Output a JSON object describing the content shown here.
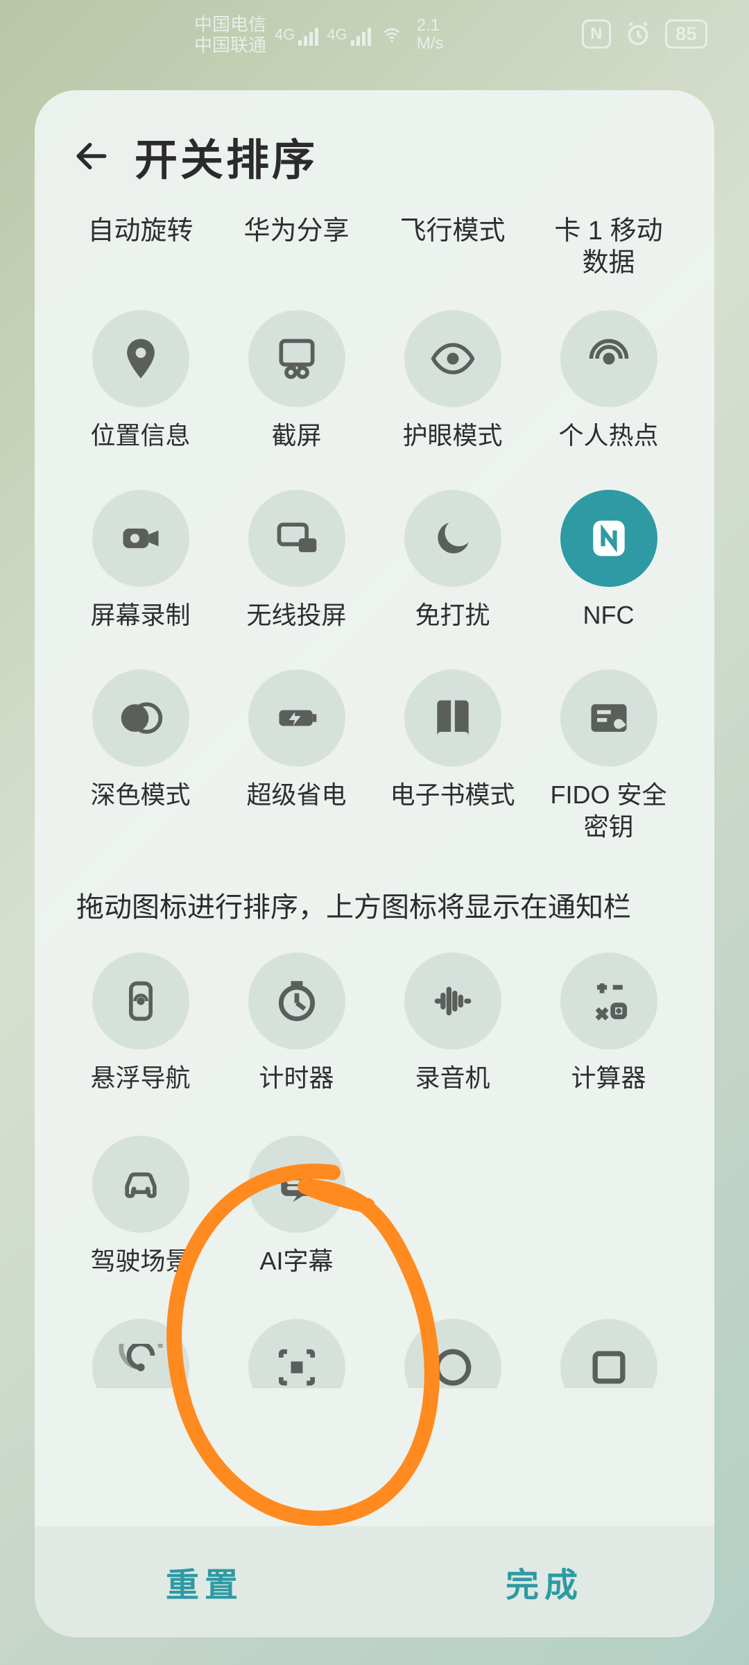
{
  "status": {
    "carrier1": "中国电信",
    "carrier2": "中国联通",
    "net_tag": "4G",
    "speed_value": "2.1",
    "speed_unit": "M/s",
    "nfc": "N",
    "battery": "85"
  },
  "header": {
    "title": "开关排序"
  },
  "top_labels": [
    "自动旋转",
    "华为分享",
    "飞行模式",
    "卡 1 移动数据"
  ],
  "toggles_row1": [
    {
      "label": "位置信息",
      "icon": "location-pin",
      "active": false
    },
    {
      "label": "截屏",
      "icon": "scissors",
      "active": false
    },
    {
      "label": "护眼模式",
      "icon": "eye",
      "active": false
    },
    {
      "label": "个人热点",
      "icon": "hotspot",
      "active": false
    }
  ],
  "toggles_row2": [
    {
      "label": "屏幕录制",
      "icon": "video-camera",
      "active": false
    },
    {
      "label": "无线投屏",
      "icon": "cast",
      "active": false
    },
    {
      "label": "免打扰",
      "icon": "moon",
      "active": false
    },
    {
      "label": "NFC",
      "icon": "nfc",
      "active": true
    }
  ],
  "toggles_row3": [
    {
      "label": "深色模式",
      "icon": "contrast",
      "active": false
    },
    {
      "label": "超级省电",
      "icon": "battery-bolt",
      "active": false
    },
    {
      "label": "电子书模式",
      "icon": "book",
      "active": false
    },
    {
      "label": "FIDO 安全密钥",
      "icon": "key-badge",
      "active": false
    }
  ],
  "hint": "拖动图标进行排序，上方图标将显示在通知栏",
  "bottom_row1": [
    {
      "label": "悬浮导航",
      "icon": "float-nav",
      "active": false
    },
    {
      "label": "计时器",
      "icon": "timer",
      "active": false
    },
    {
      "label": "录音机",
      "icon": "sound-wave",
      "active": false
    },
    {
      "label": "计算器",
      "icon": "calculator",
      "active": false
    }
  ],
  "bottom_row2": [
    {
      "label": "驾驶场景",
      "icon": "car",
      "active": false
    },
    {
      "label": "AI字幕",
      "icon": "caption",
      "active": false
    }
  ],
  "partial_icons": [
    "radar",
    "scan",
    "circle-outline",
    "square-outline"
  ],
  "footer": {
    "reset": "重置",
    "done": "完成"
  },
  "colors": {
    "accent": "#2e9aa3",
    "annotation": "#ff8a1f"
  }
}
